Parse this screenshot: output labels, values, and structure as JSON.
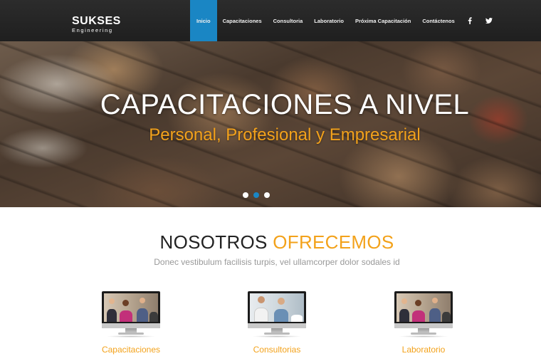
{
  "brand": {
    "name": "SUKSES",
    "tagline": "Engineering"
  },
  "nav": {
    "items": [
      {
        "label": "Inicio",
        "active": true
      },
      {
        "label": "Capacitaciones",
        "active": false
      },
      {
        "label": "Consultoria",
        "active": false
      },
      {
        "label": "Laboratorio",
        "active": false
      },
      {
        "label": "Próxima Capacitación",
        "active": false
      },
      {
        "label": "Contáctenos",
        "active": false
      }
    ],
    "social": [
      {
        "icon": "facebook-icon",
        "glyph": "f"
      },
      {
        "icon": "twitter-icon",
        "glyph": "🐦"
      }
    ]
  },
  "hero": {
    "title": "CAPACITACIONES A NIVEL",
    "subtitle": "Personal, Profesional y Empresarial",
    "slides": 3,
    "active_slide": 2
  },
  "offer": {
    "title_part1": "NOSOTROS",
    "title_part2": "OFRECEMOS",
    "subtitle": "Donec vestibulum facilisis turpis, vel ullamcorper dolor sodales id"
  },
  "services": [
    {
      "label": "Capacitaciones",
      "icon": "monitor-icon"
    },
    {
      "label": "Consultorias",
      "icon": "monitor-icon"
    },
    {
      "label": "Laboratorio",
      "icon": "monitor-icon"
    }
  ],
  "colors": {
    "accent": "#f3a21b",
    "nav_active": "#1a86c4",
    "navbar_bg": "#2a2a2a"
  }
}
